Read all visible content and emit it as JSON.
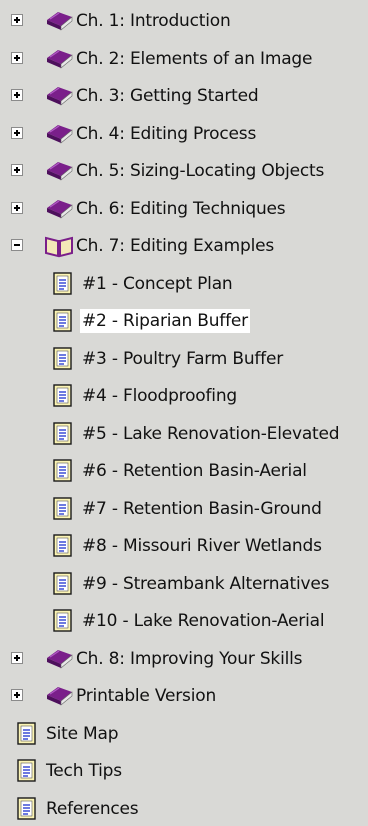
{
  "tree": {
    "chapters_top": [
      {
        "label": "Ch. 1: Introduction",
        "state": "collapsed",
        "icon": "closed-book-icon"
      },
      {
        "label": "Ch. 2: Elements of an Image",
        "state": "collapsed",
        "icon": "closed-book-icon"
      },
      {
        "label": "Ch. 3: Getting Started",
        "state": "collapsed",
        "icon": "closed-book-icon"
      },
      {
        "label": "Ch. 4: Editing Process",
        "state": "collapsed",
        "icon": "closed-book-icon"
      },
      {
        "label": "Ch. 5: Sizing-Locating Objects",
        "state": "collapsed",
        "icon": "closed-book-icon"
      },
      {
        "label": "Ch. 6: Editing Techniques",
        "state": "collapsed",
        "icon": "closed-book-icon"
      }
    ],
    "expanded_chapter": {
      "label": "Ch. 7: Editing Examples",
      "state": "expanded",
      "icon": "open-book-icon"
    },
    "examples": [
      {
        "label": "#1 - Concept Plan",
        "icon": "page-icon"
      },
      {
        "label": "#2 - Riparian Buffer",
        "icon": "page-icon",
        "selected": true
      },
      {
        "label": "#3 - Poultry Farm Buffer",
        "icon": "page-icon"
      },
      {
        "label": "#4 - Floodproofing",
        "icon": "page-icon"
      },
      {
        "label": "#5 - Lake Renovation-Elevated",
        "icon": "page-icon"
      },
      {
        "label": "#6 - Retention Basin-Aerial",
        "icon": "page-icon"
      },
      {
        "label": "#7 - Retention Basin-Ground",
        "icon": "page-icon"
      },
      {
        "label": "#8 - Missouri River Wetlands",
        "icon": "page-icon"
      },
      {
        "label": "#9 - Streambank Alternatives",
        "icon": "page-icon"
      },
      {
        "label": "#10 - Lake Renovation-Aerial",
        "icon": "page-icon"
      }
    ],
    "chapters_bottom": [
      {
        "label": "Ch. 8: Improving Your Skills",
        "state": "collapsed",
        "icon": "closed-book-icon"
      },
      {
        "label": "Printable Version",
        "state": "collapsed",
        "icon": "closed-book-icon"
      }
    ],
    "pages": [
      {
        "label": "Site Map",
        "icon": "page-icon"
      },
      {
        "label": "Tech Tips",
        "icon": "page-icon"
      },
      {
        "label": "References",
        "icon": "page-icon"
      }
    ]
  },
  "colors": {
    "background": "#d9d9d6",
    "book_purple": "#7a1f8a",
    "page_blue": "#3d4fd6",
    "selected_background": "#ffffff"
  }
}
